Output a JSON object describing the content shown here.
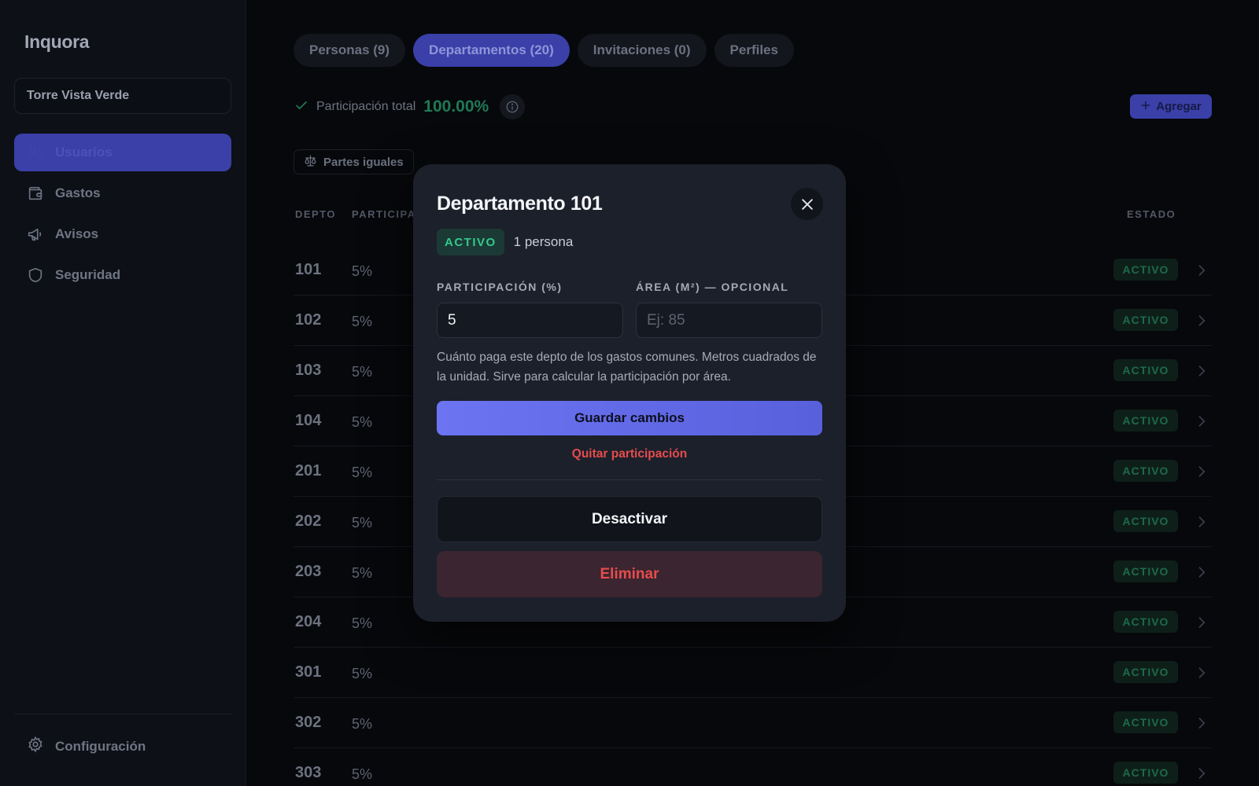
{
  "sidebar": {
    "brand": "Inquora",
    "building": "Torre Vista Verde",
    "nav": [
      {
        "label": "Usuarios",
        "icon": "users-icon",
        "active": true
      },
      {
        "label": "Gastos",
        "icon": "wallet-icon",
        "active": false
      },
      {
        "label": "Avisos",
        "icon": "megaphone-icon",
        "active": false
      },
      {
        "label": "Seguridad",
        "icon": "shield-icon",
        "active": false
      }
    ],
    "config_label": "Configuración"
  },
  "tabs": [
    {
      "label": "Personas (9)",
      "active": false
    },
    {
      "label": "Departamentos (20)",
      "active": true
    },
    {
      "label": "Invitaciones (0)",
      "active": false
    },
    {
      "label": "Perfiles",
      "active": false
    }
  ],
  "summary": {
    "participation_label": "Participación total",
    "participation_value": "100.00%",
    "add_label": "Agregar",
    "equal_label": "Partes iguales"
  },
  "table": {
    "headers": {
      "depto": "DEPTO",
      "participacion": "PARTICIPA",
      "estado": "ESTADO"
    },
    "rows": [
      {
        "depto": "101",
        "pct": "5%",
        "status": "ACTIVO"
      },
      {
        "depto": "102",
        "pct": "5%",
        "status": "ACTIVO"
      },
      {
        "depto": "103",
        "pct": "5%",
        "status": "ACTIVO"
      },
      {
        "depto": "104",
        "pct": "5%",
        "status": "ACTIVO"
      },
      {
        "depto": "201",
        "pct": "5%",
        "status": "ACTIVO"
      },
      {
        "depto": "202",
        "pct": "5%",
        "status": "ACTIVO"
      },
      {
        "depto": "203",
        "pct": "5%",
        "status": "ACTIVO"
      },
      {
        "depto": "204",
        "pct": "5%",
        "status": "ACTIVO"
      },
      {
        "depto": "301",
        "pct": "5%",
        "status": "ACTIVO"
      },
      {
        "depto": "302",
        "pct": "5%",
        "status": "ACTIVO"
      },
      {
        "depto": "303",
        "pct": "5%",
        "status": "ACTIVO"
      }
    ]
  },
  "modal": {
    "title": "Departamento 101",
    "status": "ACTIVO",
    "residents": "1 persona",
    "participation_label": "PARTICIPACIÓN (%)",
    "participation_value": "5",
    "area_label": "ÁREA (M²) — OPCIONAL",
    "area_placeholder": "Ej: 85",
    "hint": "Cuánto paga este depto de los gastos comunes. Metros cuadrados de la unidad. Sirve para calcular la participación por área.",
    "save_label": "Guardar cambios",
    "remove_label": "Quitar participación",
    "deactivate_label": "Desactivar",
    "delete_label": "Eliminar"
  },
  "colors": {
    "accent": "#5b63e6",
    "success": "#34c98b",
    "danger": "#e64c4c",
    "modal_bg": "#1c202b"
  }
}
